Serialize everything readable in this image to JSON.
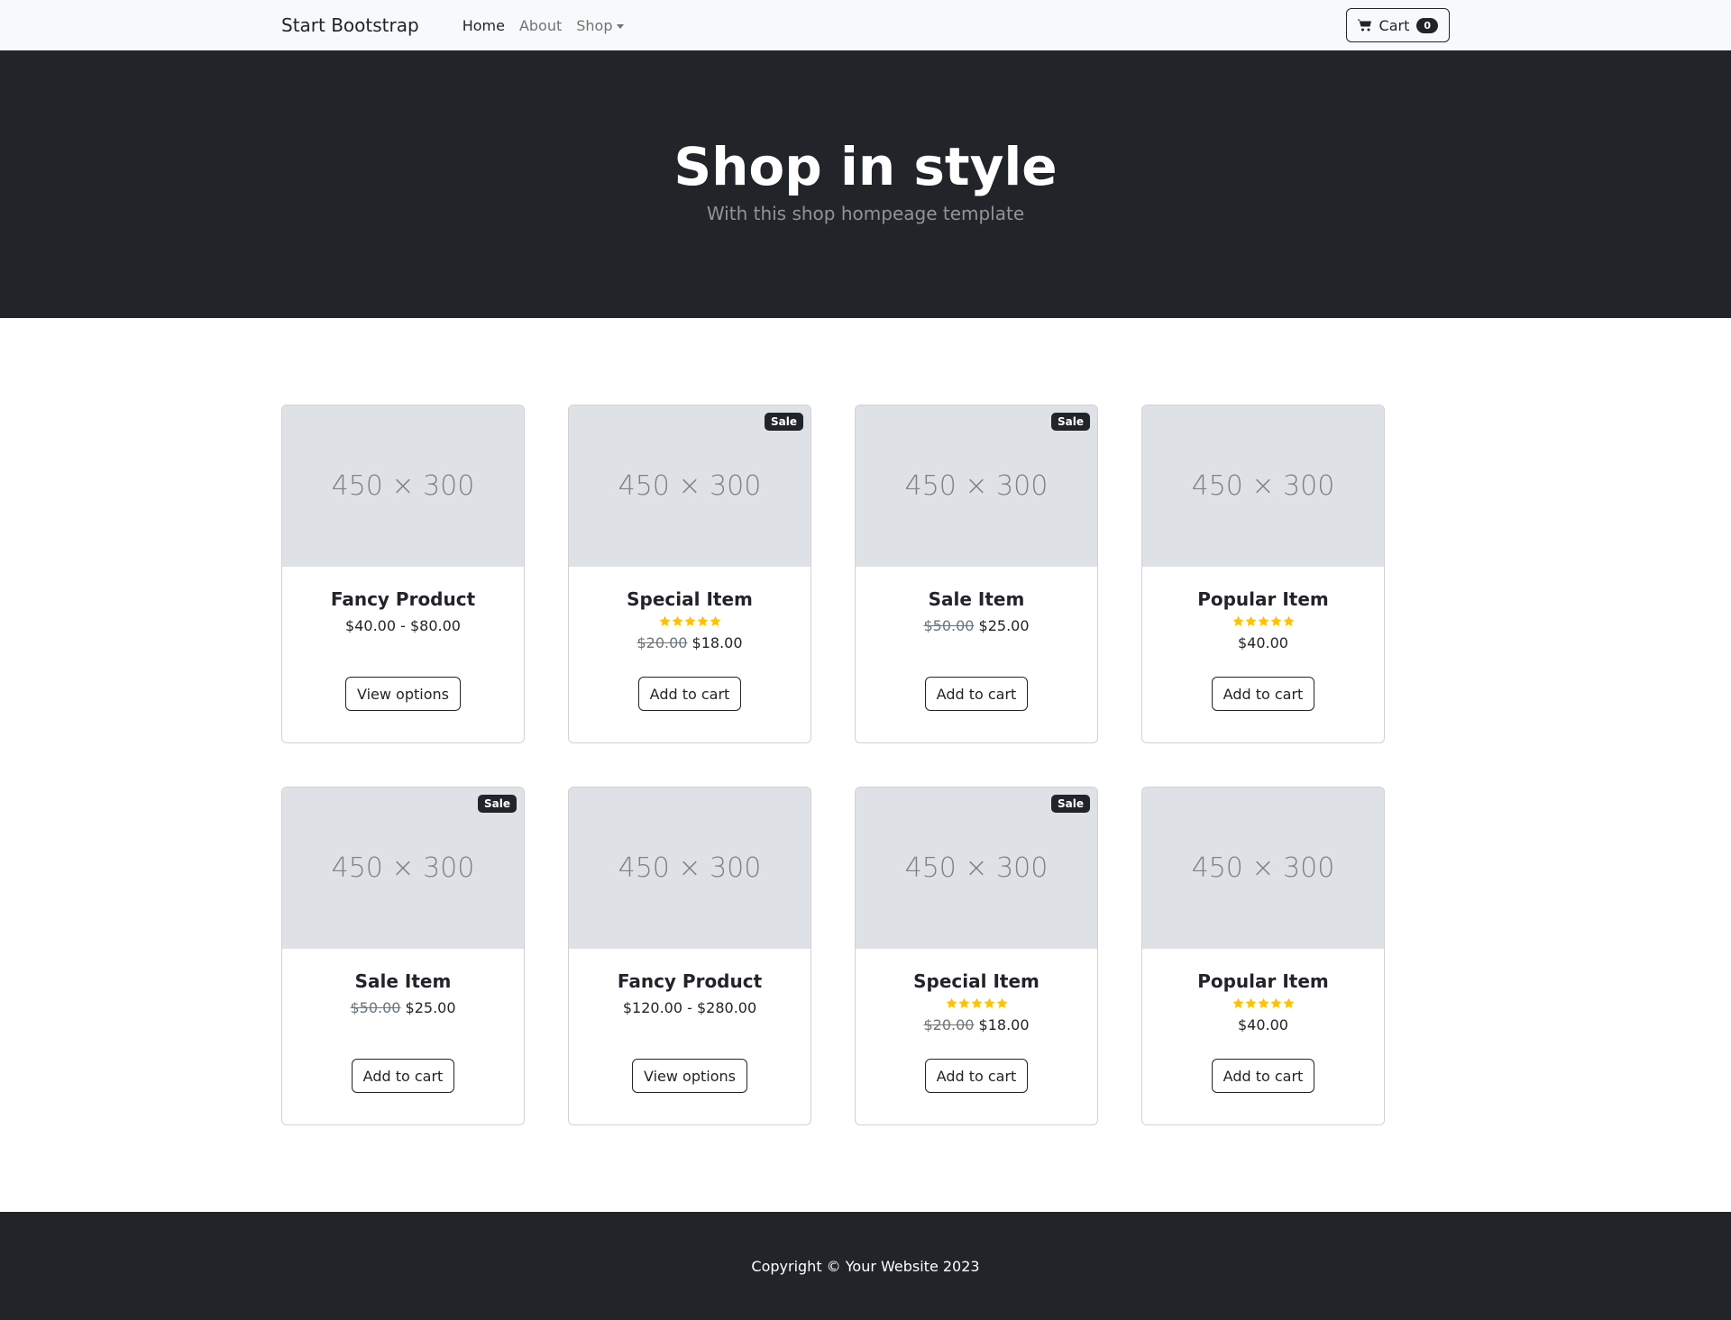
{
  "navbar": {
    "brand": "Start Bootstrap",
    "links": [
      {
        "label": "Home",
        "active": true
      },
      {
        "label": "About",
        "active": false
      },
      {
        "label": "Shop",
        "active": false,
        "dropdown": true
      }
    ],
    "cart": {
      "label": "Cart",
      "count": "0",
      "icon": "cart-icon"
    }
  },
  "hero": {
    "title": "Shop in style",
    "subtitle": "With this shop hompeage template"
  },
  "products": [
    {
      "image_text": "450 × 300",
      "sale": false,
      "sale_label": "",
      "title": "Fancy Product",
      "stars": 0,
      "old_price": "",
      "price": "$40.00 - $80.00",
      "button": "View options"
    },
    {
      "image_text": "450 × 300",
      "sale": true,
      "sale_label": "Sale",
      "title": "Special Item",
      "stars": 5,
      "old_price": "$20.00",
      "price": "$18.00",
      "button": "Add to cart"
    },
    {
      "image_text": "450 × 300",
      "sale": true,
      "sale_label": "Sale",
      "title": "Sale Item",
      "stars": 0,
      "old_price": "$50.00",
      "price": "$25.00",
      "button": "Add to cart"
    },
    {
      "image_text": "450 × 300",
      "sale": false,
      "sale_label": "",
      "title": "Popular Item",
      "stars": 5,
      "old_price": "",
      "price": "$40.00",
      "button": "Add to cart"
    },
    {
      "image_text": "450 × 300",
      "sale": true,
      "sale_label": "Sale",
      "title": "Sale Item",
      "stars": 0,
      "old_price": "$50.00",
      "price": "$25.00",
      "button": "Add to cart"
    },
    {
      "image_text": "450 × 300",
      "sale": false,
      "sale_label": "",
      "title": "Fancy Product",
      "stars": 0,
      "old_price": "",
      "price": "$120.00 - $280.00",
      "button": "View options"
    },
    {
      "image_text": "450 × 300",
      "sale": true,
      "sale_label": "Sale",
      "title": "Special Item",
      "stars": 5,
      "old_price": "$20.00",
      "price": "$18.00",
      "button": "Add to cart"
    },
    {
      "image_text": "450 × 300",
      "sale": false,
      "sale_label": "",
      "title": "Popular Item",
      "stars": 5,
      "old_price": "",
      "price": "$40.00",
      "button": "Add to cart"
    }
  ],
  "footer": {
    "copyright": "Copyright © Your Website 2023"
  },
  "colors": {
    "dark": "#212529",
    "navbar_bg": "#f8f9fa",
    "placeholder_bg": "#dee2e6",
    "star": "#ffc107",
    "muted": "#6c757d"
  }
}
